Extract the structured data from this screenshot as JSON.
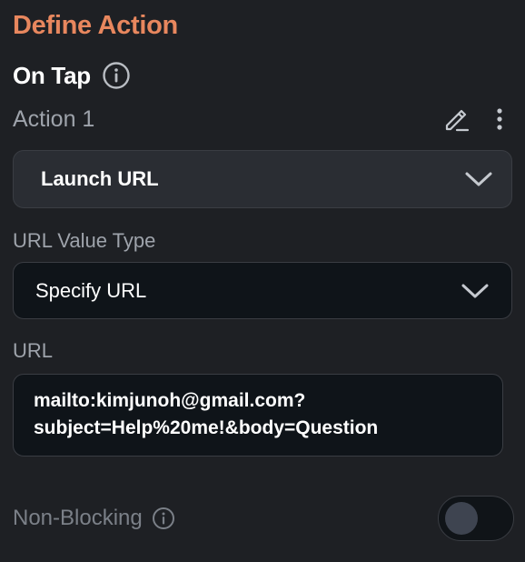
{
  "header": {
    "title": "Define Action"
  },
  "trigger": {
    "label": "On Tap",
    "info_icon": "info-icon"
  },
  "action": {
    "label": "Action 1",
    "edit_icon": "pencil-icon",
    "menu_icon": "more-vertical-icon",
    "type_select": {
      "selected": "Launch URL",
      "icon": "chevron-down-icon"
    }
  },
  "url_value_type": {
    "label": "URL Value Type",
    "selected": "Specify URL",
    "icon": "chevron-down-icon"
  },
  "url": {
    "label": "URL",
    "value_line_1": "mailto:kimjunoh@gmail.com?",
    "value_line_2": "subject=Help%20me!&body=Question"
  },
  "non_blocking": {
    "label": "Non-Blocking",
    "info_icon": "info-icon",
    "enabled": false
  },
  "colors": {
    "accent": "#e8875e",
    "background": "#1e2024",
    "muted_text": "#9ea3ab",
    "field_bg": "#0f1419"
  }
}
